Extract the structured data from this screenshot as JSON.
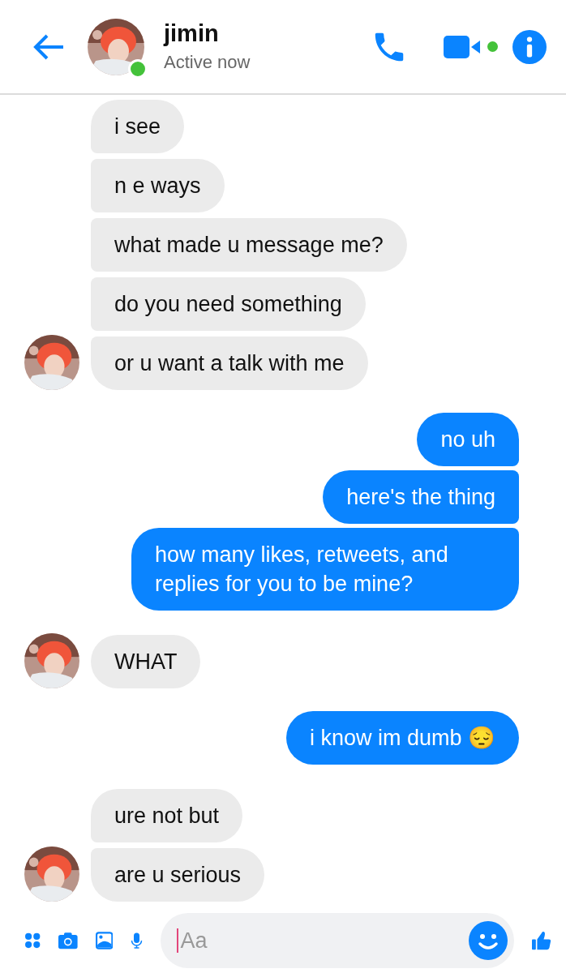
{
  "header": {
    "name": "jimin",
    "status": "Active now",
    "online": true
  },
  "messages": [
    {
      "kind": "incoming",
      "text": "i see",
      "avatar": false
    },
    {
      "kind": "incoming",
      "text": "n e ways",
      "avatar": false
    },
    {
      "kind": "incoming",
      "text": "what made u message me?",
      "avatar": false
    },
    {
      "kind": "incoming",
      "text": "do you need something",
      "avatar": false
    },
    {
      "kind": "incoming",
      "text": "or u want a talk with me",
      "avatar": true
    },
    {
      "kind": "outgoing",
      "text": "no uh"
    },
    {
      "kind": "outgoing",
      "text": "here's the thing"
    },
    {
      "kind": "outgoing",
      "text": "how many likes, retweets, and replies for you to be mine?"
    },
    {
      "kind": "incoming",
      "text": "WHAT",
      "avatar": true
    },
    {
      "kind": "outgoing",
      "text": "i know im dumb 😔"
    },
    {
      "kind": "incoming",
      "text": "ure not but",
      "avatar": false
    },
    {
      "kind": "incoming",
      "text": "are u serious",
      "avatar": true
    }
  ],
  "composer": {
    "placeholder": "Aa"
  }
}
